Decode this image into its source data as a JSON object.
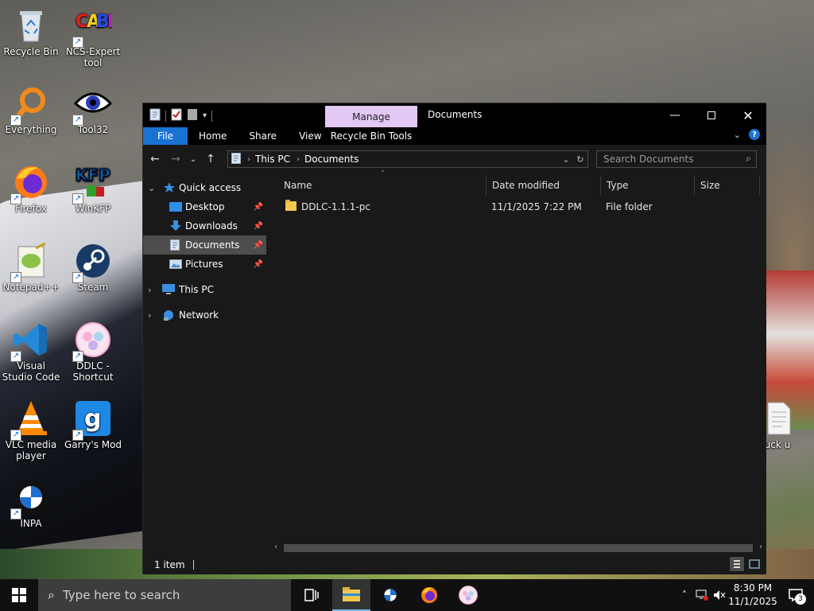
{
  "desktop": {
    "icons": [
      {
        "label": "Recycle Bin",
        "icon": "recycle-bin-icon"
      },
      {
        "label": "NCS-Expert tool",
        "icon": "ncs-expert-icon"
      },
      {
        "label": "Everything",
        "icon": "everything-search-icon"
      },
      {
        "label": "Tool32",
        "icon": "tool32-eye-icon"
      },
      {
        "label": "Firefox",
        "icon": "firefox-icon"
      },
      {
        "label": "WinKFP",
        "icon": "winkfp-icon"
      },
      {
        "label": "Notepad++",
        "icon": "notepadpp-icon"
      },
      {
        "label": "Steam",
        "icon": "steam-icon"
      },
      {
        "label": "Visual Studio Code",
        "icon": "vscode-icon"
      },
      {
        "label": "DDLC - Shortcut",
        "icon": "ddlc-icon"
      },
      {
        "label": "VLC media player",
        "icon": "vlc-icon"
      },
      {
        "label": "Garry's Mod",
        "icon": "garrys-mod-icon"
      },
      {
        "label": "INPA",
        "icon": "bmw-icon"
      },
      {
        "label": "uck u",
        "icon": "text-file-icon"
      }
    ]
  },
  "window": {
    "title": "Documents",
    "contextual_tab": "Manage",
    "ribbon_tabs": [
      "File",
      "Home",
      "Share",
      "View"
    ],
    "contextual_tools": "Recycle Bin Tools",
    "breadcrumb": [
      "This PC",
      "Documents"
    ],
    "search_placeholder": "Search Documents",
    "nav": {
      "quick_access": "Quick access",
      "items": [
        {
          "label": "Desktop",
          "pinned": true
        },
        {
          "label": "Downloads",
          "pinned": true
        },
        {
          "label": "Documents",
          "pinned": true,
          "selected": true
        },
        {
          "label": "Pictures",
          "pinned": true
        }
      ],
      "this_pc": "This PC",
      "network": "Network"
    },
    "columns": [
      "Name",
      "Date modified",
      "Type",
      "Size"
    ],
    "files": [
      {
        "name": "DDLC-1.1.1-pc",
        "date": "11/1/2025 7:22 PM",
        "type": "File folder",
        "size": ""
      }
    ],
    "status": "1 item"
  },
  "taskbar": {
    "search_placeholder": "Type here to search",
    "time": "8:30 PM",
    "date": "11/1/2025",
    "notification_count": "3",
    "pinned": [
      "task-view-icon",
      "file-explorer-icon",
      "bmw-icon",
      "firefox-icon",
      "ddlc-icon"
    ]
  },
  "colors": {
    "accent": "#1a73d3",
    "manage_tab": "#e3c8f3",
    "explorer_bg": "#191919"
  }
}
